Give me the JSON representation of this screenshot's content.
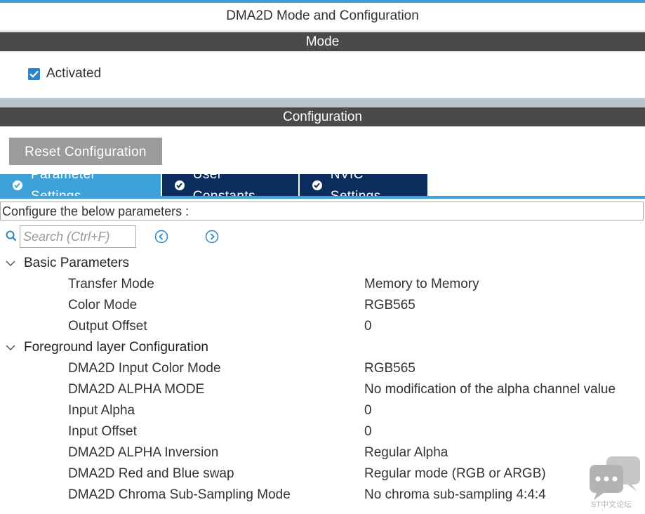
{
  "window": {
    "title": "DMA2D Mode and Configuration"
  },
  "mode": {
    "header": "Mode",
    "activated_label": "Activated",
    "activated_checked": true
  },
  "configuration": {
    "header": "Configuration",
    "reset_label": "Reset Configuration",
    "tabs": [
      {
        "label": "Parameter Settings",
        "active": true
      },
      {
        "label": "User Constants",
        "active": false
      },
      {
        "label": "NVIC Settings",
        "active": false
      }
    ],
    "instructions": "Configure the below parameters :",
    "search": {
      "placeholder": "Search (Ctrl+F)"
    }
  },
  "groups": [
    {
      "title": "Basic Parameters",
      "params": [
        {
          "name": "Transfer Mode",
          "value": "Memory to Memory"
        },
        {
          "name": "Color Mode",
          "value": "RGB565"
        },
        {
          "name": "Output Offset",
          "value": "0"
        }
      ]
    },
    {
      "title": "Foreground layer Configuration",
      "params": [
        {
          "name": "DMA2D Input Color Mode",
          "value": "RGB565"
        },
        {
          "name": "DMA2D ALPHA MODE",
          "value": "No modification of the alpha channel value"
        },
        {
          "name": "Input Alpha",
          "value": "0"
        },
        {
          "name": "Input Offset",
          "value": "0"
        },
        {
          "name": "DMA2D ALPHA Inversion",
          "value": "Regular Alpha"
        },
        {
          "name": "DMA2D Red and Blue swap",
          "value": "Regular mode (RGB or ARGB)"
        },
        {
          "name": "DMA2D Chroma Sub-Sampling Mode",
          "value": "No chroma sub-sampling 4:4:4"
        }
      ]
    }
  ],
  "watermark": {
    "text": "ST中文论坛",
    "icon": "chat-bubbles-icon"
  },
  "colors": {
    "accent": "#3ea2d8",
    "tab_inactive": "#0b2d5e",
    "header_bar": "#4a4a4a",
    "checkbox": "#2a86c9"
  }
}
